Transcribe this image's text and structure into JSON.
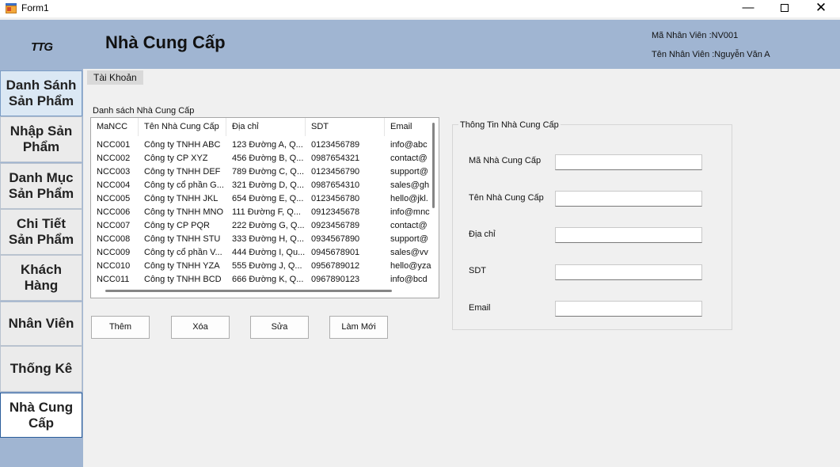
{
  "window": {
    "title": "Form1"
  },
  "header": {
    "title": "Nhà Cung Cấp",
    "employee_id": "Mã Nhân Viên :NV001",
    "employee_name": "Tên Nhân Viên :Nguyễn Văn A"
  },
  "sidebar": {
    "logo": "TTG",
    "items": [
      {
        "label": "Danh Sánh\nSản Phẩm"
      },
      {
        "label": "Nhập Sản\nPhẩm"
      },
      {
        "label": "Danh Mục\nSản Phẩm"
      },
      {
        "label": "Chi Tiết\nSản Phẩm"
      },
      {
        "label": "Khách\nHàng"
      },
      {
        "label": "Nhân Viên"
      },
      {
        "label": "Thống Kê"
      },
      {
        "label": "Nhà Cung\nCấp"
      }
    ]
  },
  "account": {
    "label": "Tài Khoản"
  },
  "list": {
    "label": "Danh sách Nhà Cung Cấp",
    "columns": [
      "MaNCC",
      "Tên Nhà Cung Cấp",
      "Địa chỉ",
      "SDT",
      "Email"
    ],
    "rows": [
      [
        "NCC001",
        "Công ty TNHH ABC",
        "123 Đường A, Q...",
        "0123456789",
        "info@abc"
      ],
      [
        "NCC002",
        "Công ty CP XYZ",
        "456 Đường B, Q...",
        "0987654321",
        "contact@"
      ],
      [
        "NCC003",
        "Công ty TNHH DEF",
        "789 Đường C, Q...",
        "0123456790",
        "support@"
      ],
      [
        "NCC004",
        "Công ty cổ phần G...",
        "321 Đường D, Q...",
        "0987654310",
        "sales@gh"
      ],
      [
        "NCC005",
        "Công ty TNHH JKL",
        "654 Đường E, Q...",
        "0123456780",
        "hello@jkl."
      ],
      [
        "NCC006",
        "Công ty TNHH MNO",
        "111 Đường F, Q...",
        "0912345678",
        "info@mnc"
      ],
      [
        "NCC007",
        "Công ty CP PQR",
        "222 Đường G, Q...",
        "0923456789",
        "contact@"
      ],
      [
        "NCC008",
        "Công ty TNHH STU",
        "333 Đường H, Q...",
        "0934567890",
        "support@"
      ],
      [
        "NCC009",
        "Công ty cổ phần V...",
        "444 Đường I, Qu...",
        "0945678901",
        "sales@vv"
      ],
      [
        "NCC010",
        "Công ty TNHH YZA",
        "555 Đường J, Q...",
        "0956789012",
        "hello@yza"
      ],
      [
        "NCC011",
        "Công ty TNHH BCD",
        "666 Đường K, Q...",
        "0967890123",
        "info@bcd"
      ]
    ]
  },
  "actions": {
    "add": "Thêm",
    "delete": "Xóa",
    "edit": "Sửa",
    "refresh": "Làm Mới"
  },
  "details": {
    "title": "Thông Tin Nhà Cung Cấp",
    "fields": [
      {
        "label": "Mã Nhà Cung Cấp",
        "value": ""
      },
      {
        "label": "Tên Nhà Cung Cấp",
        "value": ""
      },
      {
        "label": "Địa chỉ",
        "value": ""
      },
      {
        "label": "SDT",
        "value": ""
      },
      {
        "label": "Email",
        "value": ""
      }
    ]
  }
}
